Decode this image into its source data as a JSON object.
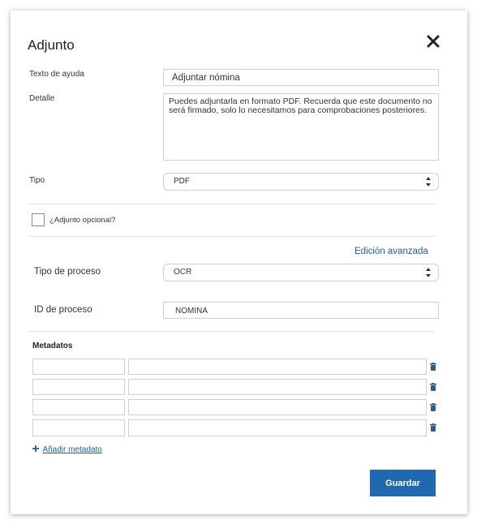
{
  "modal": {
    "title": "Adjunto"
  },
  "help_text": {
    "label": "Texto de ayuda",
    "value": "Adjuntar nómina"
  },
  "detail": {
    "label": "Detalle",
    "value": "Puedes adjuntarla en formato PDF. Recuerda que este documento no será firmado, solo lo necesitamos para comprobaciones posteriores."
  },
  "type": {
    "label": "Tipo",
    "value": "PDF"
  },
  "optional": {
    "label": "¿Adjunto opcional?",
    "checked": false
  },
  "advanced": {
    "link": "Edición avanzada",
    "process_type_label": "Tipo de proceso",
    "process_type_value": "OCR",
    "process_id_label": "ID de proceso",
    "process_id_value": "NOMINA"
  },
  "metadata": {
    "heading": "Metadatos",
    "rows": [
      {
        "key": "",
        "value": ""
      },
      {
        "key": "",
        "value": ""
      },
      {
        "key": "",
        "value": ""
      },
      {
        "key": "",
        "value": ""
      }
    ],
    "add_label": "Añadir metadato"
  },
  "actions": {
    "save_label": "Guardar"
  },
  "colors": {
    "accent": "#1f69b1",
    "link": "#1c5c95",
    "trash_icon": "#2e5a8c"
  },
  "icons": {
    "close": "close-icon",
    "select_arrows": "updown-arrows-icon",
    "trash": "trash-icon",
    "add": "plus-icon"
  }
}
